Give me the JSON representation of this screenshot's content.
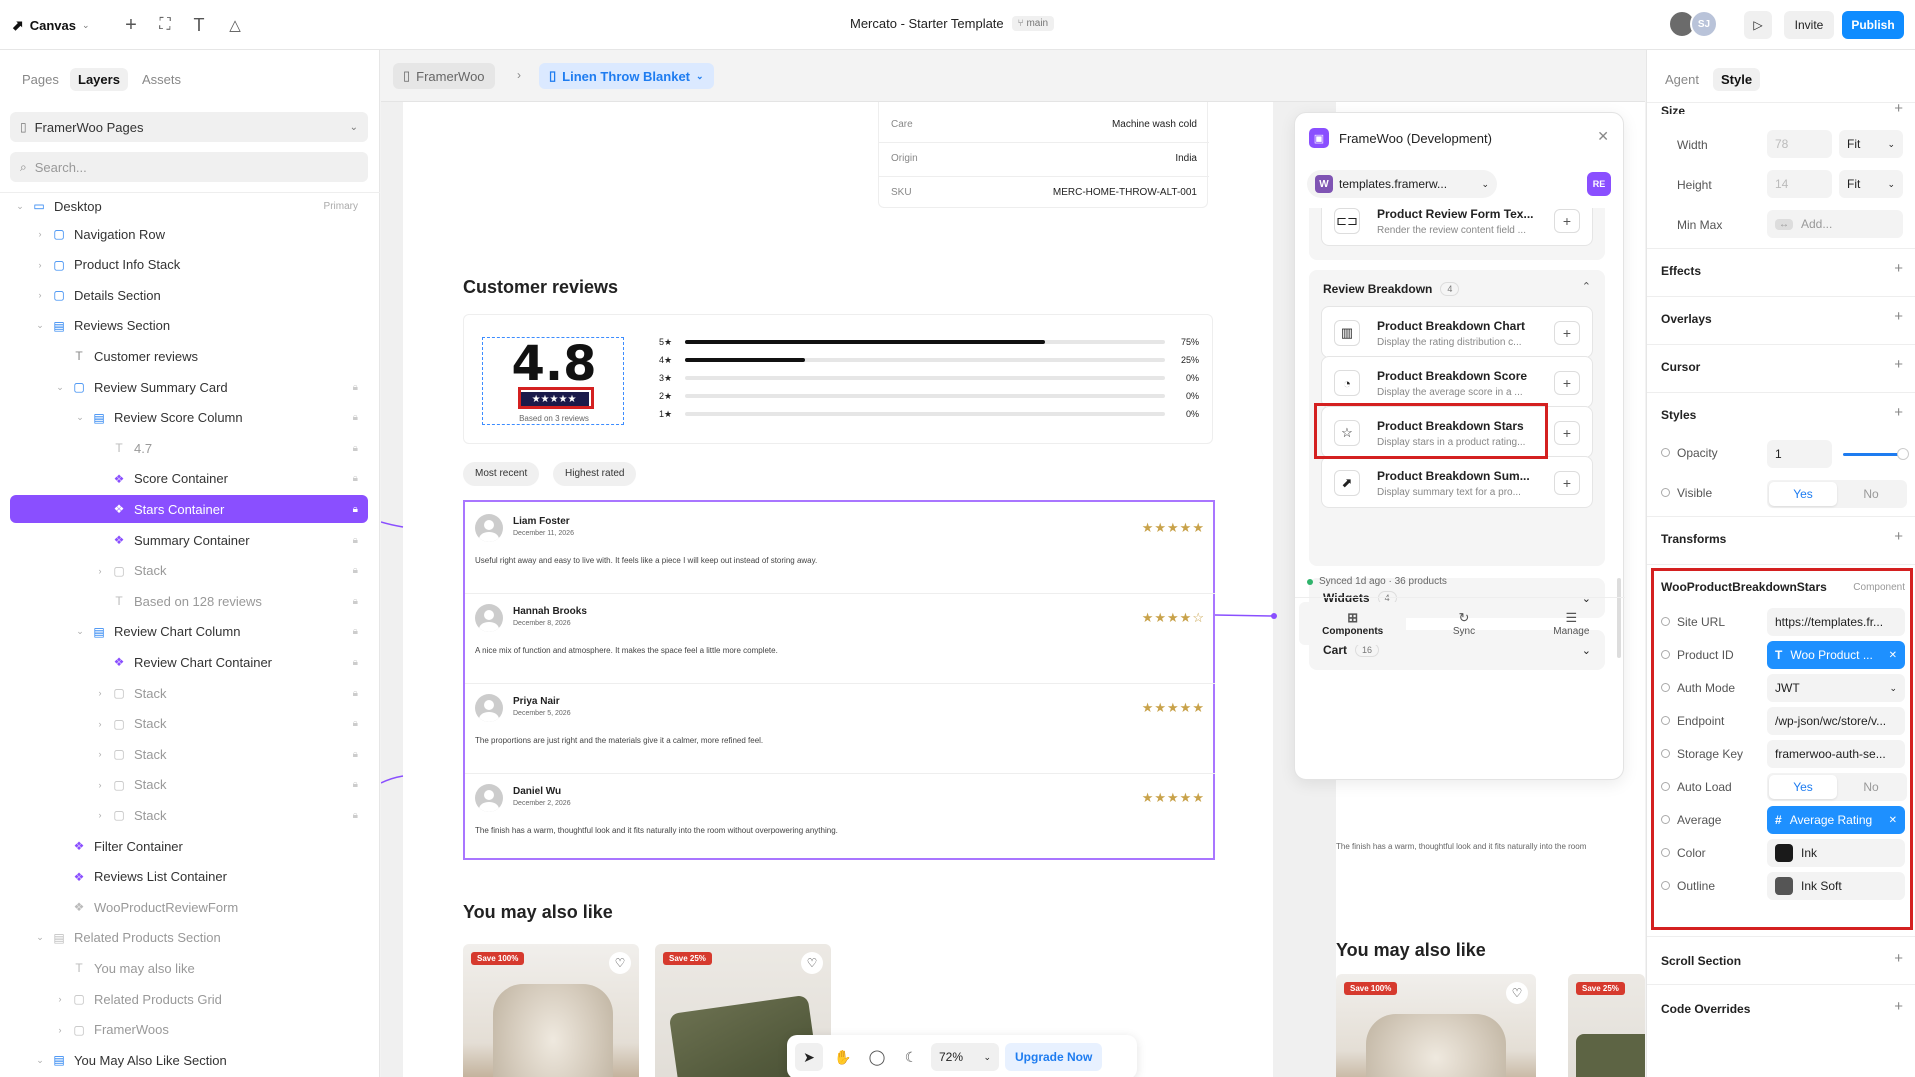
{
  "app": {
    "menu_label": "Canvas",
    "title": "Mercato - Starter Template",
    "branch": "main",
    "invite_label": "Invite",
    "publish_label": "Publish",
    "avatar_initials": "SJ"
  },
  "left": {
    "tabs": [
      "Pages",
      "Layers",
      "Assets"
    ],
    "page_select": "FramerWoo Pages",
    "search_placeholder": "Search...",
    "root": {
      "label": "Desktop",
      "tag": "Primary"
    },
    "layers": [
      {
        "label": "Navigation Row",
        "icon": "frame-icon",
        "indent": 1,
        "chev": "›"
      },
      {
        "label": "Product Info Stack",
        "icon": "frame-icon",
        "indent": 1,
        "chev": "›"
      },
      {
        "label": "Details Section",
        "icon": "frame-icon",
        "indent": 1,
        "chev": "›"
      },
      {
        "label": "Reviews Section",
        "icon": "stack-icon",
        "indent": 1,
        "chev": "⌄"
      },
      {
        "label": "Customer reviews",
        "icon": "text-icon",
        "indent": 2,
        "chev": ""
      },
      {
        "label": "Review Summary Card",
        "icon": "frame-icon",
        "indent": 2,
        "chev": "⌄",
        "lock": true
      },
      {
        "label": "Review Score Column",
        "icon": "stack-icon",
        "indent": 3,
        "chev": "⌄",
        "lock": true
      },
      {
        "label": "4.7",
        "icon": "text-icon",
        "indent": 4,
        "chev": "",
        "lock": true,
        "dim": true
      },
      {
        "label": "Score Container",
        "icon": "component-icon",
        "indent": 4,
        "chev": "",
        "lock": true
      },
      {
        "label": "Stars Container",
        "icon": "component-icon",
        "indent": 4,
        "chev": "",
        "lock": true,
        "selected": true
      },
      {
        "label": "Summary Container",
        "icon": "component-icon",
        "indent": 4,
        "chev": "",
        "lock": true
      },
      {
        "label": "Stack",
        "icon": "frame-icon",
        "indent": 4,
        "chev": "›",
        "lock": true,
        "dim": true
      },
      {
        "label": "Based on 128 reviews",
        "icon": "text-icon",
        "indent": 4,
        "chev": "",
        "lock": true,
        "dim": true
      },
      {
        "label": "Review Chart Column",
        "icon": "stack-icon",
        "indent": 3,
        "chev": "⌄",
        "lock": true
      },
      {
        "label": "Review Chart Container",
        "icon": "component-icon",
        "indent": 4,
        "chev": "",
        "lock": true
      },
      {
        "label": "Stack",
        "icon": "frame-icon",
        "indent": 4,
        "chev": "›",
        "lock": true,
        "dim": true
      },
      {
        "label": "Stack",
        "icon": "frame-icon",
        "indent": 4,
        "chev": "›",
        "lock": true,
        "dim": true
      },
      {
        "label": "Stack",
        "icon": "frame-icon",
        "indent": 4,
        "chev": "›",
        "lock": true,
        "dim": true
      },
      {
        "label": "Stack",
        "icon": "frame-icon",
        "indent": 4,
        "chev": "›",
        "lock": true,
        "dim": true
      },
      {
        "label": "Stack",
        "icon": "frame-icon",
        "indent": 4,
        "chev": "›",
        "lock": true,
        "dim": true
      },
      {
        "label": "Filter Container",
        "icon": "component-icon",
        "indent": 2,
        "chev": ""
      },
      {
        "label": "Reviews List Container",
        "icon": "component-icon",
        "indent": 2,
        "chev": ""
      },
      {
        "label": "WooProductReviewForm",
        "icon": "component-icon",
        "indent": 2,
        "chev": "",
        "dim": true
      },
      {
        "label": "Related Products Section",
        "icon": "stack-icon",
        "indent": 1,
        "chev": "⌄",
        "dim": true
      },
      {
        "label": "You may also like",
        "icon": "text-icon",
        "indent": 2,
        "chev": "",
        "dim": true
      },
      {
        "label": "Related Products Grid",
        "icon": "frame-icon",
        "indent": 2,
        "chev": "›",
        "dim": true
      },
      {
        "label": "FramerWoos",
        "icon": "frame-icon",
        "indent": 2,
        "chev": "›",
        "dim": true
      },
      {
        "label": "You May Also Like Section",
        "icon": "stack-icon",
        "indent": 1,
        "chev": "⌄"
      }
    ]
  },
  "canvas": {
    "crumb_root": "FramerWoo",
    "crumb_page": "Linen Throw Blanket",
    "specs": [
      [
        "Care",
        "Machine wash cold"
      ],
      [
        "Origin",
        "India"
      ],
      [
        "SKU",
        "MERC-HOME-THROW-ALT-001"
      ]
    ],
    "reviews_heading": "Customer reviews",
    "score": "4.8",
    "score_stars": "★★★★★",
    "based_on": "Based on 3 reviews",
    "breakdown": [
      {
        "label": "5★",
        "pct": "75%",
        "fill": 0.75
      },
      {
        "label": "4★",
        "pct": "25%",
        "fill": 0.25
      },
      {
        "label": "3★",
        "pct": "0%",
        "fill": 0
      },
      {
        "label": "2★",
        "pct": "0%",
        "fill": 0
      },
      {
        "label": "1★",
        "pct": "0%",
        "fill": 0
      }
    ],
    "filters": [
      "Most recent",
      "Highest rated"
    ],
    "reviews": [
      {
        "name": "Liam Foster",
        "date": "December 11, 2026",
        "text": "Useful right away and easy to live with. It feels like a piece I will keep out instead of storing away.",
        "stars": "★★★★★"
      },
      {
        "name": "Hannah Brooks",
        "date": "December 8, 2026",
        "text": "A nice mix of function and atmosphere. It makes the space feel a little more complete.",
        "stars": "★★★★☆"
      },
      {
        "name": "Priya Nair",
        "date": "December 5, 2026",
        "text": "The proportions are just right and the materials give it a calmer, more refined feel.",
        "stars": "★★★★★"
      },
      {
        "name": "Daniel Wu",
        "date": "December 2, 2026",
        "text": "The finish has a warm, thoughtful look and it fits naturally into the room without overpowering anything.",
        "stars": "★★★★★"
      }
    ],
    "also_like": "You may also like",
    "badges": [
      "Save 100%",
      "Save 25%"
    ],
    "right_also_like": "You may also like",
    "right_badges": [
      "Save 100%",
      "Save 25%"
    ],
    "right_review_text": "The finish has a warm, thoughtful look and it fits naturally into the room",
    "toolbar": {
      "zoom": "72%",
      "upgrade": "Upgrade Now"
    }
  },
  "plugin": {
    "title": "FrameWoo (Development)",
    "site": "templates.framerw...",
    "user_badge": "RE",
    "top_item": {
      "title": "Product Review Form Tex...",
      "desc": "Render the review content field ..."
    },
    "group": {
      "title": "Review Breakdown",
      "count": "4"
    },
    "items": [
      {
        "title": "Product Breakdown Chart",
        "desc": "Display the rating distribution c...",
        "icon": "chart-icon"
      },
      {
        "title": "Product Breakdown Score",
        "desc": "Display the average score in a ...",
        "icon": "gauge-icon"
      },
      {
        "title": "Product Breakdown Stars",
        "desc": "Display stars in a product rating...",
        "icon": "star-icon"
      },
      {
        "title": "Product Breakdown Sum...",
        "desc": "Display summary text for a pro...",
        "icon": "summary-icon"
      }
    ],
    "widgets": {
      "title": "Widgets",
      "count": "4"
    },
    "cart": {
      "title": "Cart",
      "count": "16"
    },
    "sync": "Synced 1d ago · 36 products",
    "nav": [
      "Components",
      "Sync",
      "Manage"
    ]
  },
  "right": {
    "tabs": [
      "Agent",
      "Style"
    ],
    "size_title": "Size",
    "width": {
      "label": "Width",
      "value": "78",
      "mode": "Fit"
    },
    "height": {
      "label": "Height",
      "value": "14",
      "mode": "Fit"
    },
    "minmax": {
      "label": "Min Max",
      "placeholder": "Add..."
    },
    "sections": [
      "Effects",
      "Overlays",
      "Cursor",
      "Styles"
    ],
    "opacity": {
      "label": "Opacity",
      "value": "1"
    },
    "visible": {
      "label": "Visible",
      "yes": "Yes",
      "no": "No"
    },
    "transforms": "Transforms",
    "component": {
      "name": "WooProductBreakdownStars",
      "tag": "Component"
    },
    "props": [
      {
        "label": "Site URL",
        "value": "https://templates.fr...",
        "kind": "text"
      },
      {
        "label": "Product ID",
        "value": "Woo Product ...",
        "kind": "chip",
        "glyph": "T"
      },
      {
        "label": "Auth Mode",
        "value": "JWT",
        "kind": "select"
      },
      {
        "label": "Endpoint",
        "value": "/wp-json/wc/store/v...",
        "kind": "text"
      },
      {
        "label": "Storage Key",
        "value": "framerwoo-auth-se...",
        "kind": "text"
      },
      {
        "label": "Auto Load",
        "yes": "Yes",
        "no": "No",
        "kind": "seg"
      },
      {
        "label": "Average",
        "value": "Average Rating",
        "kind": "chip",
        "glyph": "#"
      },
      {
        "label": "Color",
        "value": "Ink",
        "kind": "color",
        "swatch": "#1a1a1a"
      },
      {
        "label": "Outline",
        "value": "Ink Soft",
        "kind": "color",
        "swatch": "#555555"
      }
    ],
    "scroll_section": "Scroll Section",
    "code_overrides": "Code Overrides"
  }
}
